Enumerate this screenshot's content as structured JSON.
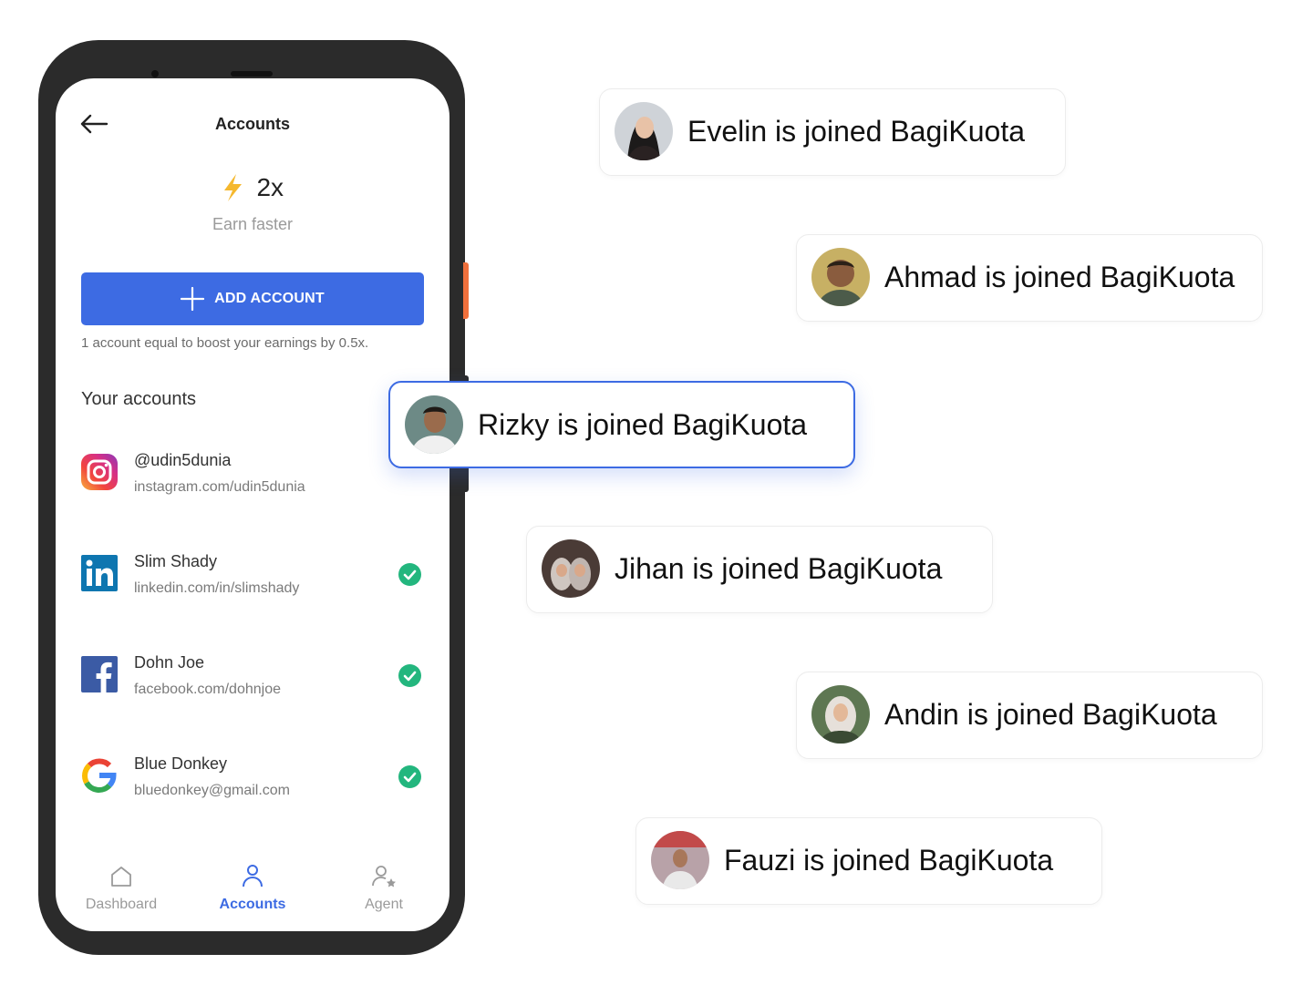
{
  "screen": {
    "title": "Accounts",
    "multiplier": "2x",
    "subtitle": "Earn faster",
    "add_button": "ADD ACCOUNT",
    "hint": "1 account equal to boost your earnings by 0.5x.",
    "section_title": "Your accounts"
  },
  "accounts": [
    {
      "name": "@udin5dunia",
      "url": "instagram.com/udin5dunia",
      "icon": "instagram-icon",
      "verified": true
    },
    {
      "name": "Slim Shady",
      "url": "linkedin.com/in/slimshady",
      "icon": "linkedin-icon",
      "verified": true
    },
    {
      "name": "Dohn Joe",
      "url": "facebook.com/dohnjoe",
      "icon": "facebook-icon",
      "verified": true
    },
    {
      "name": "Blue Donkey",
      "url": "bluedonkey@gmail.com",
      "icon": "google-icon",
      "verified": true
    }
  ],
  "nav": [
    {
      "label": "Dashboard",
      "icon": "home-icon",
      "active": false
    },
    {
      "label": "Accounts",
      "icon": "user-icon",
      "active": true
    },
    {
      "label": "Agent",
      "icon": "user-star-icon",
      "active": false
    }
  ],
  "notifications": [
    {
      "text": "Evelin is joined BagiKuota",
      "active": false
    },
    {
      "text": "Ahmad is joined BagiKuota",
      "active": false
    },
    {
      "text": "Rizky is joined BagiKuota",
      "active": true
    },
    {
      "text": "Jihan is joined BagiKuota",
      "active": false
    },
    {
      "text": "Andin is joined BagiKuota",
      "active": false
    },
    {
      "text": "Fauzi is joined BagiKuota",
      "active": false
    }
  ],
  "colors": {
    "accent": "#3d6be3",
    "success": "#23b67e",
    "bolt": "#f5b82e",
    "phone_frame": "#2b2b2b",
    "side_button": "#f0703c",
    "muted_text": "#9a9a9a",
    "inactive_nav": "#9a9a9a"
  }
}
